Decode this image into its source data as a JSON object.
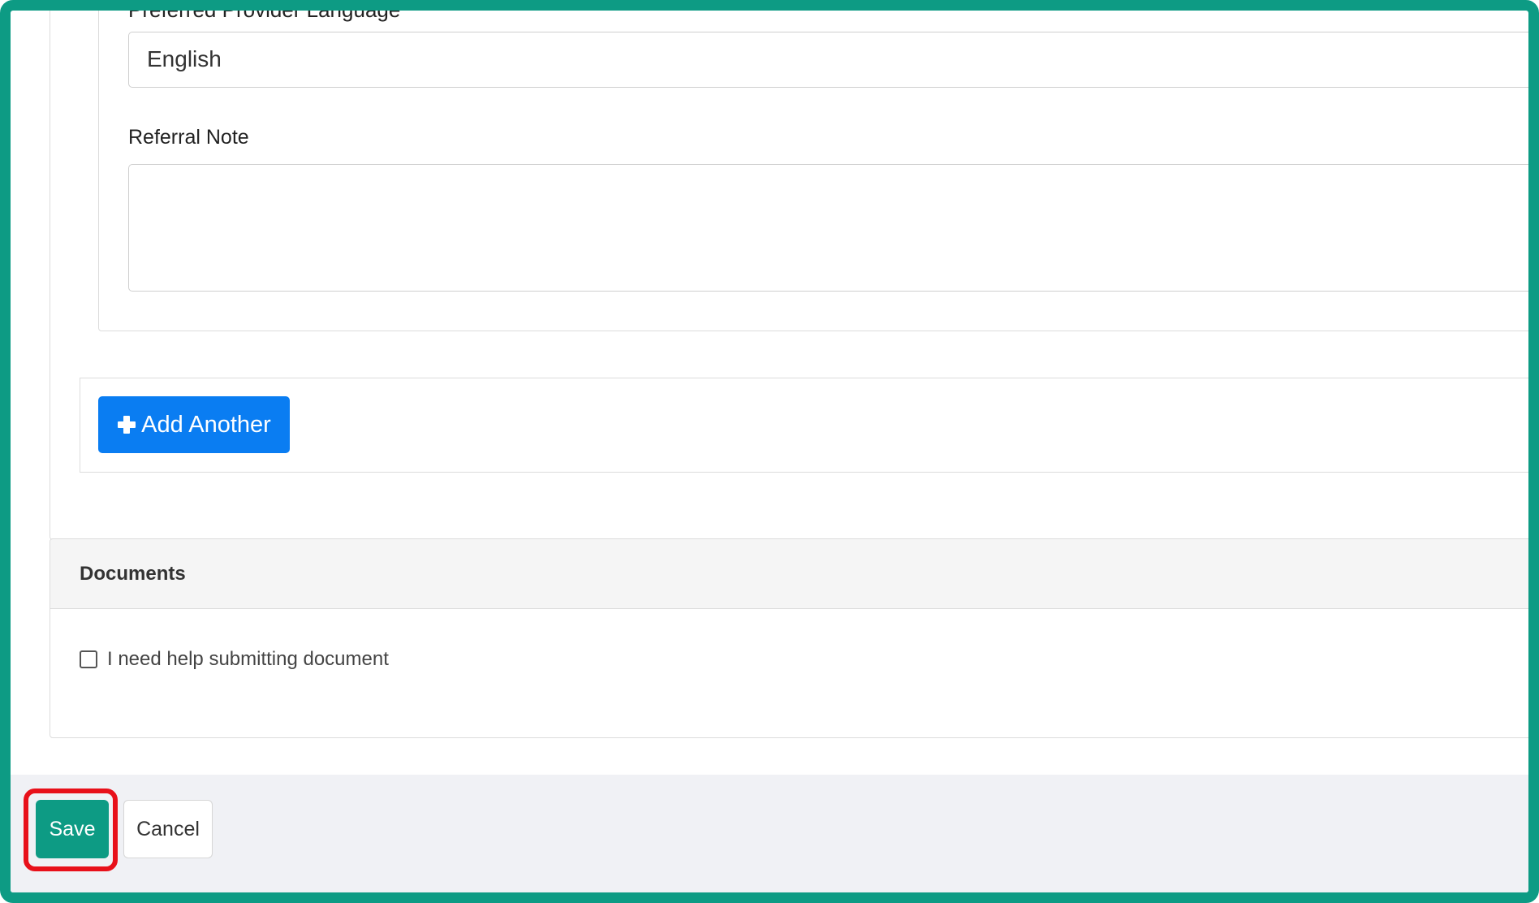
{
  "form": {
    "preferred_language_label": "Preferred Provider Language",
    "preferred_language_value": "English",
    "referral_note_label": "Referral Note",
    "referral_note_value": "",
    "add_another_label": "Add Another"
  },
  "documents": {
    "title": "Documents",
    "help_checkbox_label": "I need help submitting document",
    "help_checked": false
  },
  "actions": {
    "save_label": "Save",
    "cancel_label": "Cancel"
  },
  "colors": {
    "accent": "#0d9b84",
    "primary_button": "#0a7df2",
    "highlight": "#e8101a"
  },
  "icons": {
    "add": "plus-icon"
  }
}
